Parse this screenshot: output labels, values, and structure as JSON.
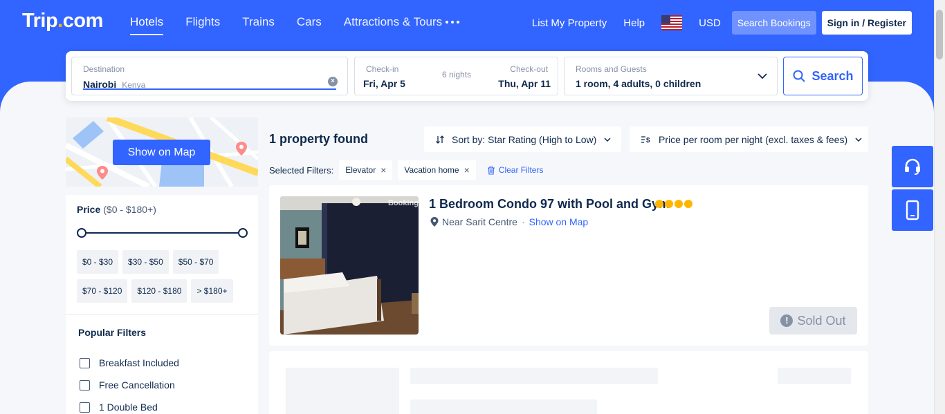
{
  "header": {
    "logo_main": "Trip",
    "logo_dot": ".",
    "logo_tail": "com",
    "nav": [
      "Hotels",
      "Flights",
      "Trains",
      "Cars",
      "Attractions & Tours"
    ],
    "list_property": "List My Property",
    "help": "Help",
    "currency": "USD",
    "search_bookings": "Search Bookings",
    "sign_in": "Sign in / Register"
  },
  "search": {
    "destination_label": "Destination",
    "destination_value": "Nairobi",
    "destination_sub": "Kenya",
    "checkin_label": "Check-in",
    "checkin_value": "Fri, Apr 5",
    "nights": "6 nights",
    "checkout_label": "Check-out",
    "checkout_value": "Thu, Apr 11",
    "rooms_label": "Rooms and Guests",
    "rooms_value": "1 room, 4 adults, 0 children",
    "search_button": "Search"
  },
  "map": {
    "show_on_map": "Show on Map"
  },
  "filters": {
    "price_title": "Price",
    "price_range": "($0 - $180+)",
    "price_chips": [
      "$0 - $30",
      "$30 - $50",
      "$50 - $70",
      "$70 - $120",
      "$120 - $180",
      "> $180+"
    ],
    "popular_title": "Popular Filters",
    "popular_items": [
      "Breakfast Included",
      "Free Cancellation",
      "1 Double Bed"
    ]
  },
  "results": {
    "count": "1 property found",
    "sort_label": "Sort by: Star Rating (High to Low)",
    "price_label": "Price per room per night (excl. taxes & fees)",
    "selected_filters_label": "Selected Filters:",
    "selected_tags": [
      "Elevator",
      "Vacation home"
    ],
    "clear_filters": "Clear Filters"
  },
  "hotel": {
    "name": "1 Bedroom Condo 97 with Pool and Gym",
    "stars": 4,
    "location": "Near Sarit Centre",
    "show_on_map": "Show on Map",
    "photo_watermark": "Booking",
    "sold_out": "Sold Out"
  },
  "colors": {
    "brand_blue": "#3264ff",
    "star_yellow": "#ffb600",
    "text_dark": "#0f294d"
  }
}
